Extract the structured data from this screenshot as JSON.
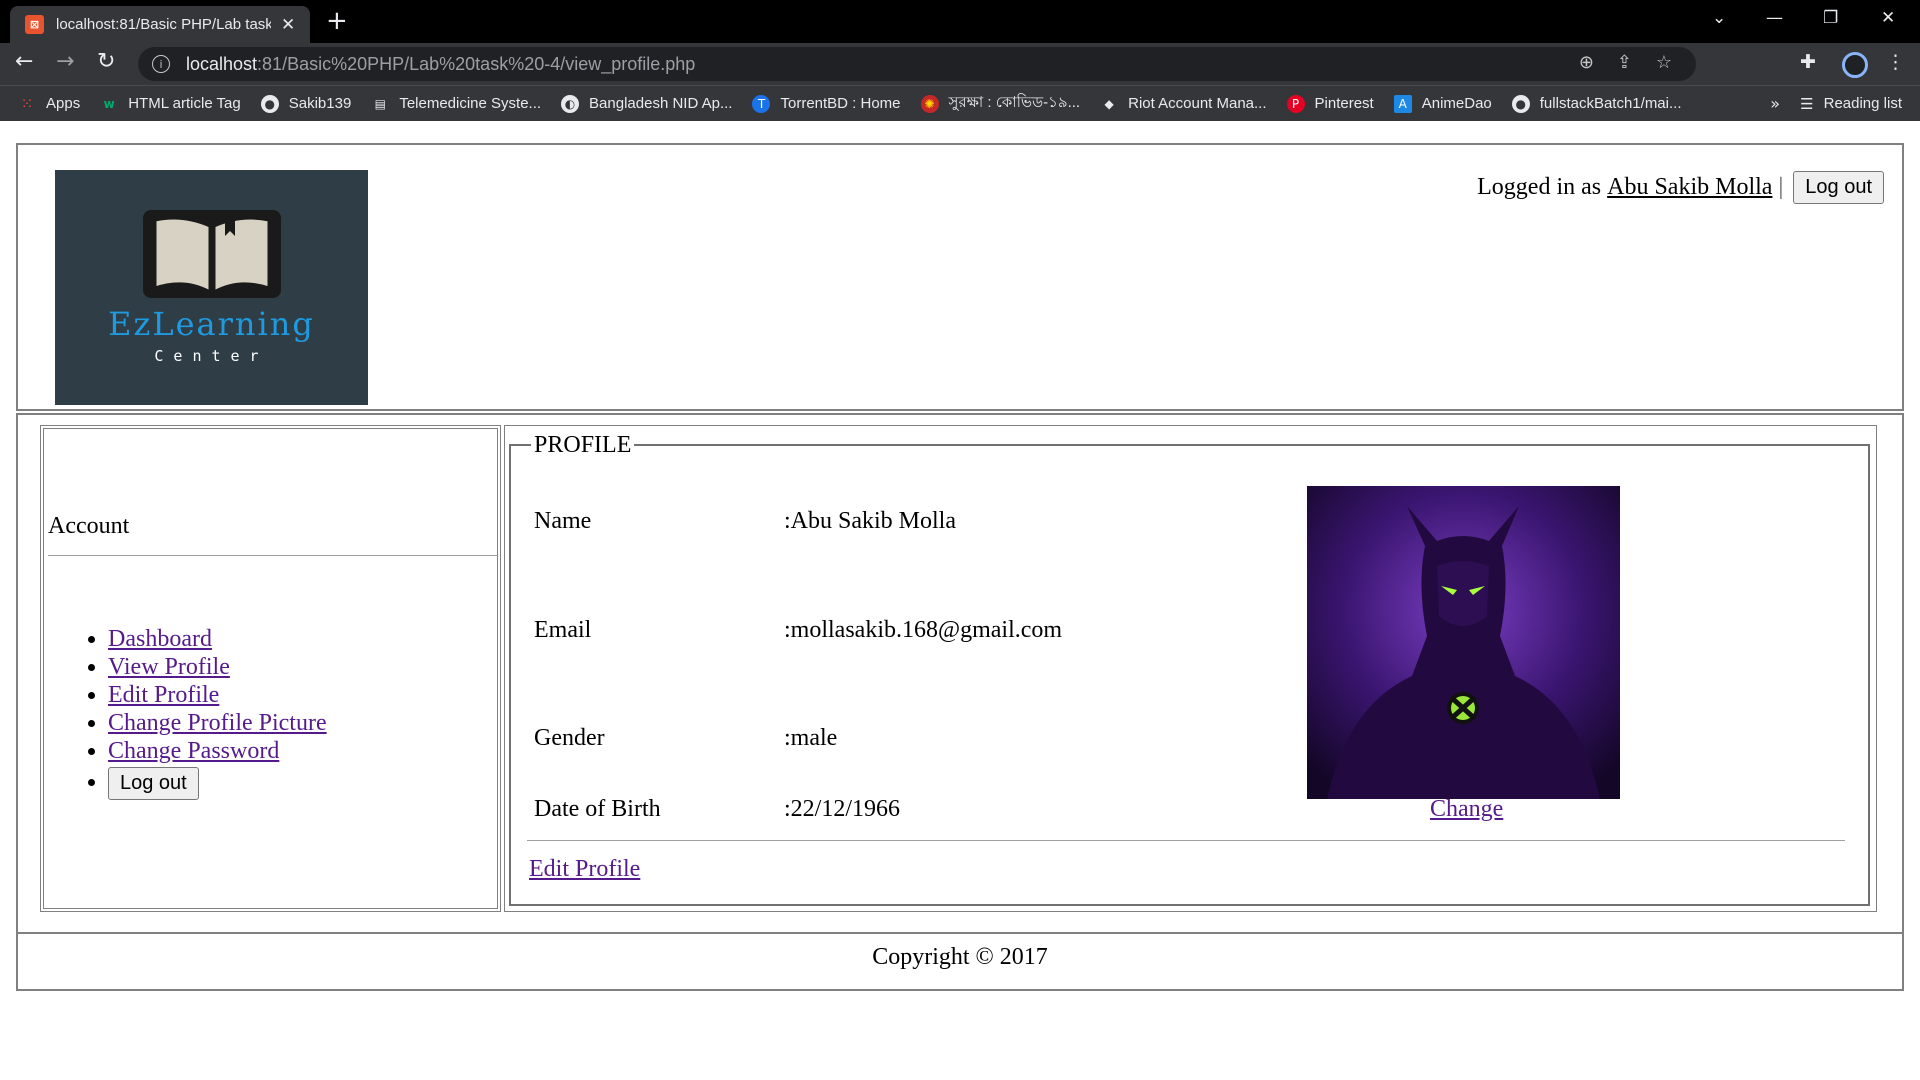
{
  "browser": {
    "tab_title": "localhost:81/Basic PHP/Lab task",
    "tab_favicon_text": "⊠",
    "url_host": "localhost",
    "url_path": ":81/Basic%20PHP/Lab%20task%20-4/view_profile.php",
    "bookmarks": [
      {
        "label": "Apps",
        "icon": "apps-grid-icon"
      },
      {
        "label": "HTML article Tag",
        "icon": "w3-icon"
      },
      {
        "label": "Sakib139",
        "icon": "github-icon"
      },
      {
        "label": "Telemedicine Syste...",
        "icon": "doc-icon"
      },
      {
        "label": "Bangladesh NID Ap...",
        "icon": "globe-icon"
      },
      {
        "label": "TorrentBD : Home",
        "icon": "torrent-icon"
      },
      {
        "label": "সুরক্ষা : কোভিড-১৯...",
        "icon": "gov-icon"
      },
      {
        "label": "Riot Account Mana...",
        "icon": "riot-icon"
      },
      {
        "label": "Pinterest",
        "icon": "pinterest-icon"
      },
      {
        "label": "AnimeDao",
        "icon": "animedao-icon"
      },
      {
        "label": "fullstackBatch1/mai...",
        "icon": "github-icon"
      }
    ],
    "more_bookmarks": "»",
    "reading_list": "Reading list"
  },
  "header": {
    "logo_title": "EzLearning",
    "logo_subtitle": "Center",
    "logged_in_prefix": "Logged in as",
    "user_name": "Abu Sakib Molla",
    "separator": "|",
    "logout_label": "Log out"
  },
  "sidebar": {
    "title": "Account",
    "items": [
      {
        "label": "Dashboard"
      },
      {
        "label": "View Profile"
      },
      {
        "label": "Edit Profile"
      },
      {
        "label": "Change Profile Picture"
      },
      {
        "label": "Change Password"
      }
    ],
    "logout_label": "Log out"
  },
  "profile": {
    "legend": "PROFILE",
    "fields": [
      {
        "label": "Name",
        "value": ":Abu Sakib Molla"
      },
      {
        "label": "Email",
        "value": ":mollasakib.168@gmail.com"
      },
      {
        "label": "Gender",
        "value": ":male"
      },
      {
        "label": "Date of Birth",
        "value": ":22/12/1966"
      }
    ],
    "change_label": "Change",
    "edit_label": "Edit Profile"
  },
  "footer": {
    "copyright": "Copyright © 2017"
  },
  "colors": {
    "link": "#551a8b",
    "logo_bg": "#2f3e46",
    "logo_text": "#1e9be0"
  }
}
